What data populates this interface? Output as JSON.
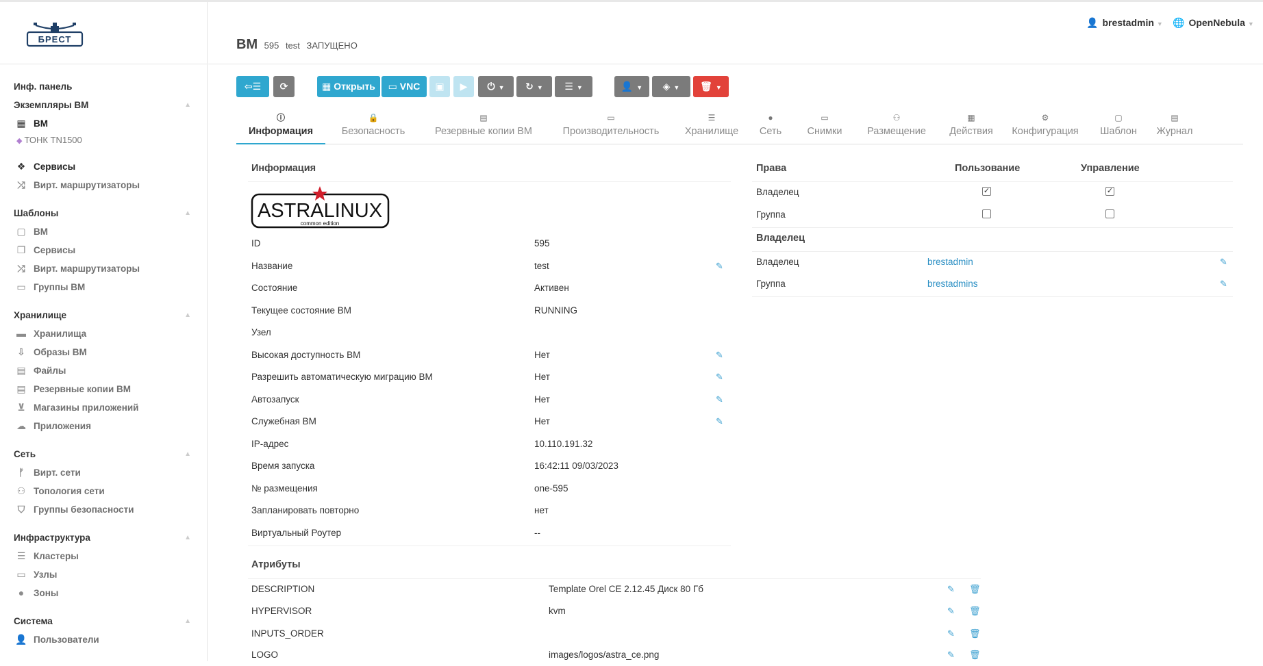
{
  "brand": {
    "logo_text": "БРЕСТ"
  },
  "header": {
    "title": "ВМ",
    "vm_id": "595",
    "vm_name": "test",
    "vm_state": "ЗАПУЩЕНО",
    "user": "brestadmin",
    "zone": "OpenNebula"
  },
  "sidebar": {
    "dashboard": "Инф. панель",
    "vm_instances": "Экземпляры ВМ",
    "vm": "ВМ",
    "tag": "ТОНК TN1500",
    "services": "Сервисы",
    "vrouters": "Вирт. маршрутизаторы",
    "templates": "Шаблоны",
    "tpl_vm": "ВМ",
    "tpl_services": "Сервисы",
    "tpl_vrouters": "Вирт. маршрутизаторы",
    "tpl_groups": "Группы ВМ",
    "storage": "Хранилище",
    "datastores": "Хранилища",
    "images": "Образы ВМ",
    "files": "Файлы",
    "backups": "Резервные копии ВМ",
    "marketplaces": "Магазины приложений",
    "apps": "Приложения",
    "network": "Сеть",
    "vnets": "Вирт. сети",
    "topology": "Топология сети",
    "secgroups": "Группы безопасности",
    "infrastructure": "Инфраструктура",
    "clusters": "Кластеры",
    "hosts": "Узлы",
    "zones": "Зоны",
    "system": "Система",
    "users": "Пользователи"
  },
  "toolbar": {
    "open_label": "Открыть",
    "vnc_label": "VNC"
  },
  "tabs": [
    "Информация",
    "Безопасность",
    "Резервные копии ВМ",
    "Производительность",
    "Хранилище",
    "Сеть",
    "Снимки",
    "Размещение",
    "Действия",
    "Конфигурация",
    "Шаблон",
    "Журнал"
  ],
  "info": {
    "title": "Информация",
    "os_logo": "ASTRALINUX",
    "os_logo_sub": "common edition",
    "rows": [
      {
        "k": "ID",
        "v": "595"
      },
      {
        "k": "Название",
        "v": "test"
      },
      {
        "k": "Состояние",
        "v": "Активен"
      },
      {
        "k": "Текущее состояние ВМ",
        "v": "RUNNING"
      },
      {
        "k": "Узел",
        "v": ""
      },
      {
        "k": "Высокая доступность ВМ",
        "v": "Нет"
      },
      {
        "k": "Разрешить автоматическую миграцию ВМ",
        "v": "Нет"
      },
      {
        "k": "Автозапуск",
        "v": "Нет"
      },
      {
        "k": "Служебная ВМ",
        "v": "Нет"
      },
      {
        "k": "IP-адрес",
        "v": "10.110.191.32"
      },
      {
        "k": "Время запуска",
        "v": "16:42:11 09/03/2023"
      },
      {
        "k": "№ размещения",
        "v": "one-595"
      },
      {
        "k": "Запланировать повторно",
        "v": "нет"
      },
      {
        "k": "Виртуальный Роутер",
        "v": "--"
      }
    ]
  },
  "perms": {
    "title": "Права",
    "use": "Пользование",
    "manage": "Управление",
    "owner": "Владелец",
    "group": "Группа",
    "owner_use": true,
    "owner_manage": true,
    "group_use": false,
    "group_manage": false
  },
  "ownership": {
    "title": "Владелец",
    "owner_label": "Владелец",
    "owner_value": "brestadmin",
    "group_label": "Группа",
    "group_value": "brestadmins"
  },
  "attributes": {
    "title": "Атрибуты",
    "rows": [
      {
        "k": "DESCRIPTION",
        "v": "Template Orel CE 2.12.45 Диск 80 Гб"
      },
      {
        "k": "HYPERVISOR",
        "v": "kvm"
      },
      {
        "k": "INPUTS_ORDER",
        "v": ""
      },
      {
        "k": "LOGO",
        "v": "images/logos/astra_ce.png"
      }
    ]
  }
}
